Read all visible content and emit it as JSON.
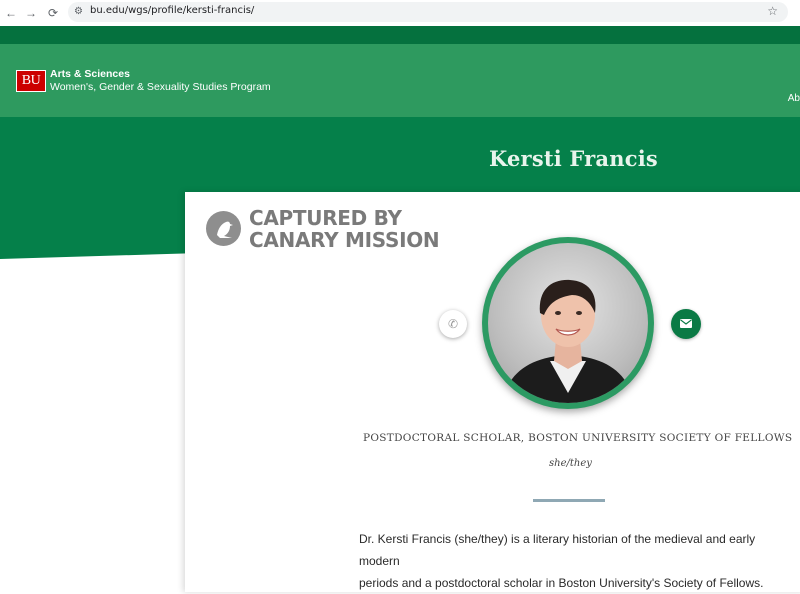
{
  "browser": {
    "back_icon": "←",
    "forward_icon": "→",
    "reload_icon": "⟳",
    "site_settings_icon": "⚙",
    "url": "bu.edu/wgs/profile/kersti-francis/",
    "bookmark_icon": "☆"
  },
  "header": {
    "logo_text": "BU",
    "college": "Arts & Sciences",
    "program": "Women's, Gender & Sexuality Studies Program",
    "nav_peek": "Ab"
  },
  "profile": {
    "name": "Kersti Francis",
    "title": "POSTDOCTORAL SCHOLAR, BOSTON UNIVERSITY SOCIETY OF FELLOWS",
    "pronouns": "she/they",
    "bio_line1": "Dr. Kersti Francis (she/they) is a literary historian of the medieval and early modern",
    "bio_line2": "periods and a postdoctoral scholar in Boston University's Society of Fellows.",
    "phone_icon": "phone-icon",
    "email_icon": "mail-icon"
  },
  "watermark": {
    "line1": "CAPTURED BY",
    "line2": "CANARY MISSION"
  },
  "colors": {
    "header_dark": "#05713e",
    "header_green": "#2e9a5f",
    "hero_green": "#05804a",
    "logo_red": "#cc0000",
    "email_button": "#0a7a45"
  }
}
